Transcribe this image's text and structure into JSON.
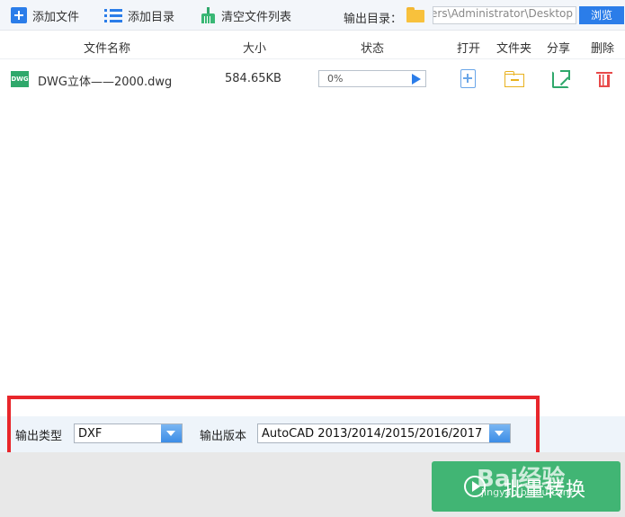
{
  "toolbar": {
    "add_file_label": "添加文件",
    "add_dir_label": "添加目录",
    "clear_list_label": "清空文件列表",
    "output_dir_label": "输出目录：",
    "output_dir_value": "C:\\Users\\Administrator\\Desktop",
    "browse_label": "浏览"
  },
  "table": {
    "headers": {
      "name": "文件名称",
      "size": "大小",
      "status": "状态",
      "open": "打开",
      "folder": "文件夹",
      "share": "分享",
      "delete": "删除"
    },
    "rows": [
      {
        "icon_text": "DWG",
        "name": "DWG立体——2000.dwg",
        "size": "584.65KB",
        "progress_text": "0%",
        "progress": 0
      }
    ]
  },
  "settings": {
    "output_type_label": "输出类型",
    "output_type_value": "DXF",
    "output_version_label": "输出版本",
    "output_version_value": "AutoCAD 2013/2014/2015/2016/2017"
  },
  "footer": {
    "convert_label": "批量转换"
  },
  "watermark": {
    "brand": "Bai经验",
    "url": "jingyan.baidu.com"
  },
  "colors": {
    "accent": "#2b7de9",
    "green": "#41b574",
    "highlight": "#e8262b",
    "delete": "#e84a4a"
  }
}
